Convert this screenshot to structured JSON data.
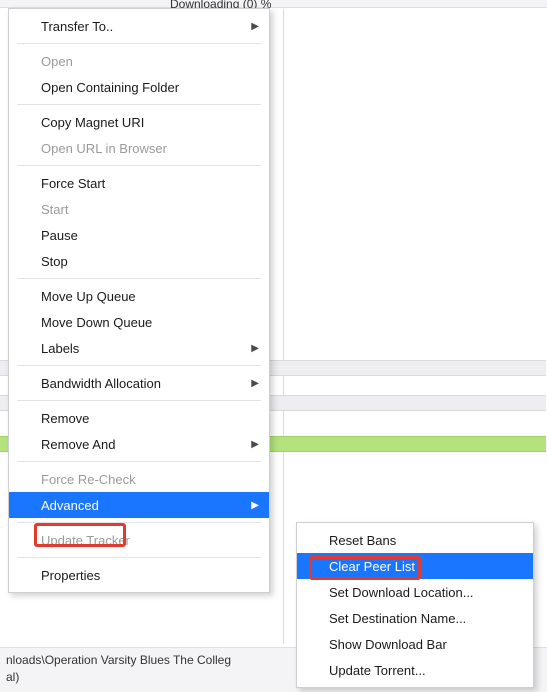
{
  "header_fragment": "Downloading (0) %",
  "background": {
    "path_text_line1": "nloads\\Operation Varsity Blues The Colleg",
    "path_text_line2": "al)"
  },
  "main_menu": {
    "transfer_to": "Transfer To..",
    "open": "Open",
    "open_containing_folder": "Open Containing Folder",
    "copy_magnet_uri": "Copy Magnet URI",
    "open_url_in_browser": "Open URL in Browser",
    "force_start": "Force Start",
    "start": "Start",
    "pause": "Pause",
    "stop": "Stop",
    "move_up_queue": "Move Up Queue",
    "move_down_queue": "Move Down Queue",
    "labels": "Labels",
    "bandwidth_allocation": "Bandwidth Allocation",
    "remove": "Remove",
    "remove_and": "Remove And",
    "force_recheck": "Force Re-Check",
    "advanced": "Advanced",
    "update_tracker": "Update Tracker",
    "properties": "Properties"
  },
  "sub_menu": {
    "reset_bans": "Reset Bans",
    "clear_peer_list": "Clear Peer List",
    "set_download_location": "Set Download Location...",
    "set_destination_name": "Set Destination Name...",
    "show_download_bar": "Show Download Bar",
    "update_torrent": "Update Torrent..."
  }
}
